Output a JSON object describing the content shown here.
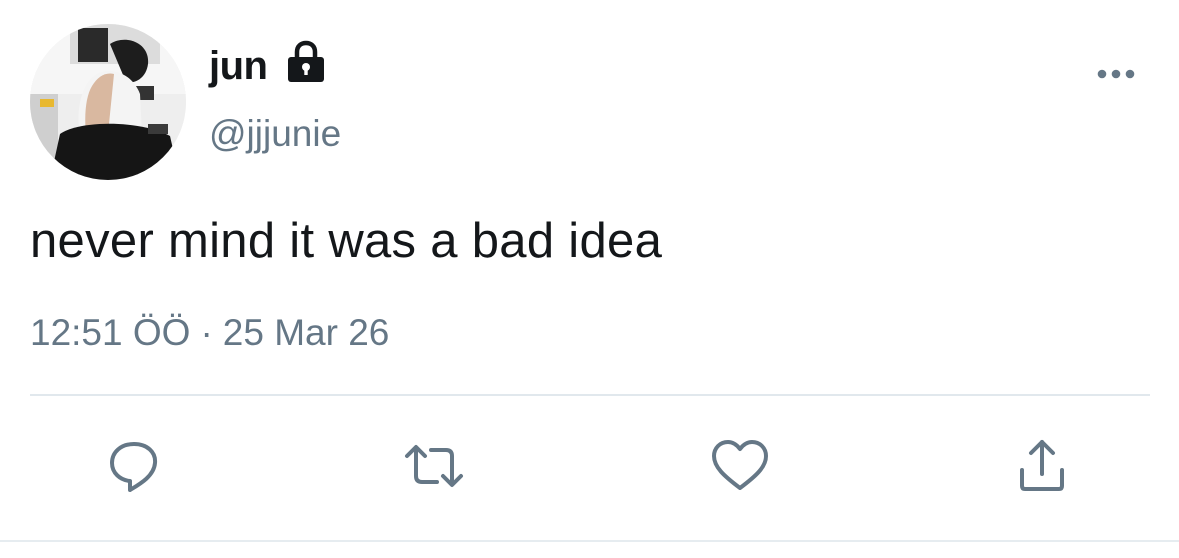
{
  "user": {
    "display_name": "jun",
    "handle": "@jjjunie",
    "protected_icon": "lock-icon",
    "avatar": "profile-photo"
  },
  "tweet": {
    "text": "never mind it was a bad idea",
    "time": "12:51 ÖÖ",
    "separator": "·",
    "date": "25 Mar 26"
  },
  "actions": {
    "reply": "reply-icon",
    "retweet": "retweet-icon",
    "like": "heart-icon",
    "share": "share-icon",
    "more": "more-icon"
  },
  "colors": {
    "text": "#14171a",
    "secondary": "#657786",
    "divider": "#e1e8ed"
  }
}
